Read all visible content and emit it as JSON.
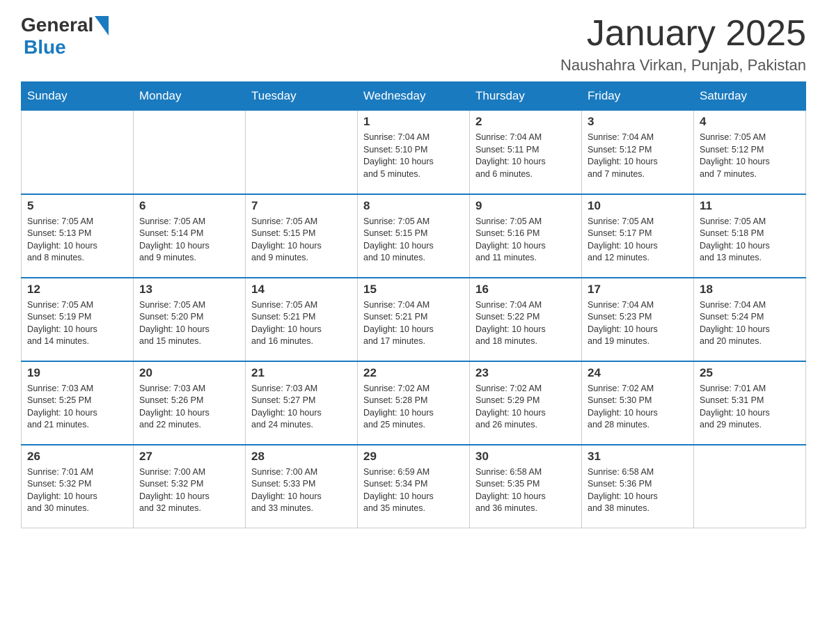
{
  "header": {
    "logo_general": "General",
    "logo_blue": "Blue",
    "month_title": "January 2025",
    "location": "Naushahra Virkan, Punjab, Pakistan"
  },
  "weekdays": [
    "Sunday",
    "Monday",
    "Tuesday",
    "Wednesday",
    "Thursday",
    "Friday",
    "Saturday"
  ],
  "weeks": [
    [
      {
        "day": "",
        "info": ""
      },
      {
        "day": "",
        "info": ""
      },
      {
        "day": "",
        "info": ""
      },
      {
        "day": "1",
        "info": "Sunrise: 7:04 AM\nSunset: 5:10 PM\nDaylight: 10 hours\nand 5 minutes."
      },
      {
        "day": "2",
        "info": "Sunrise: 7:04 AM\nSunset: 5:11 PM\nDaylight: 10 hours\nand 6 minutes."
      },
      {
        "day": "3",
        "info": "Sunrise: 7:04 AM\nSunset: 5:12 PM\nDaylight: 10 hours\nand 7 minutes."
      },
      {
        "day": "4",
        "info": "Sunrise: 7:05 AM\nSunset: 5:12 PM\nDaylight: 10 hours\nand 7 minutes."
      }
    ],
    [
      {
        "day": "5",
        "info": "Sunrise: 7:05 AM\nSunset: 5:13 PM\nDaylight: 10 hours\nand 8 minutes."
      },
      {
        "day": "6",
        "info": "Sunrise: 7:05 AM\nSunset: 5:14 PM\nDaylight: 10 hours\nand 9 minutes."
      },
      {
        "day": "7",
        "info": "Sunrise: 7:05 AM\nSunset: 5:15 PM\nDaylight: 10 hours\nand 9 minutes."
      },
      {
        "day": "8",
        "info": "Sunrise: 7:05 AM\nSunset: 5:15 PM\nDaylight: 10 hours\nand 10 minutes."
      },
      {
        "day": "9",
        "info": "Sunrise: 7:05 AM\nSunset: 5:16 PM\nDaylight: 10 hours\nand 11 minutes."
      },
      {
        "day": "10",
        "info": "Sunrise: 7:05 AM\nSunset: 5:17 PM\nDaylight: 10 hours\nand 12 minutes."
      },
      {
        "day": "11",
        "info": "Sunrise: 7:05 AM\nSunset: 5:18 PM\nDaylight: 10 hours\nand 13 minutes."
      }
    ],
    [
      {
        "day": "12",
        "info": "Sunrise: 7:05 AM\nSunset: 5:19 PM\nDaylight: 10 hours\nand 14 minutes."
      },
      {
        "day": "13",
        "info": "Sunrise: 7:05 AM\nSunset: 5:20 PM\nDaylight: 10 hours\nand 15 minutes."
      },
      {
        "day": "14",
        "info": "Sunrise: 7:05 AM\nSunset: 5:21 PM\nDaylight: 10 hours\nand 16 minutes."
      },
      {
        "day": "15",
        "info": "Sunrise: 7:04 AM\nSunset: 5:21 PM\nDaylight: 10 hours\nand 17 minutes."
      },
      {
        "day": "16",
        "info": "Sunrise: 7:04 AM\nSunset: 5:22 PM\nDaylight: 10 hours\nand 18 minutes."
      },
      {
        "day": "17",
        "info": "Sunrise: 7:04 AM\nSunset: 5:23 PM\nDaylight: 10 hours\nand 19 minutes."
      },
      {
        "day": "18",
        "info": "Sunrise: 7:04 AM\nSunset: 5:24 PM\nDaylight: 10 hours\nand 20 minutes."
      }
    ],
    [
      {
        "day": "19",
        "info": "Sunrise: 7:03 AM\nSunset: 5:25 PM\nDaylight: 10 hours\nand 21 minutes."
      },
      {
        "day": "20",
        "info": "Sunrise: 7:03 AM\nSunset: 5:26 PM\nDaylight: 10 hours\nand 22 minutes."
      },
      {
        "day": "21",
        "info": "Sunrise: 7:03 AM\nSunset: 5:27 PM\nDaylight: 10 hours\nand 24 minutes."
      },
      {
        "day": "22",
        "info": "Sunrise: 7:02 AM\nSunset: 5:28 PM\nDaylight: 10 hours\nand 25 minutes."
      },
      {
        "day": "23",
        "info": "Sunrise: 7:02 AM\nSunset: 5:29 PM\nDaylight: 10 hours\nand 26 minutes."
      },
      {
        "day": "24",
        "info": "Sunrise: 7:02 AM\nSunset: 5:30 PM\nDaylight: 10 hours\nand 28 minutes."
      },
      {
        "day": "25",
        "info": "Sunrise: 7:01 AM\nSunset: 5:31 PM\nDaylight: 10 hours\nand 29 minutes."
      }
    ],
    [
      {
        "day": "26",
        "info": "Sunrise: 7:01 AM\nSunset: 5:32 PM\nDaylight: 10 hours\nand 30 minutes."
      },
      {
        "day": "27",
        "info": "Sunrise: 7:00 AM\nSunset: 5:32 PM\nDaylight: 10 hours\nand 32 minutes."
      },
      {
        "day": "28",
        "info": "Sunrise: 7:00 AM\nSunset: 5:33 PM\nDaylight: 10 hours\nand 33 minutes."
      },
      {
        "day": "29",
        "info": "Sunrise: 6:59 AM\nSunset: 5:34 PM\nDaylight: 10 hours\nand 35 minutes."
      },
      {
        "day": "30",
        "info": "Sunrise: 6:58 AM\nSunset: 5:35 PM\nDaylight: 10 hours\nand 36 minutes."
      },
      {
        "day": "31",
        "info": "Sunrise: 6:58 AM\nSunset: 5:36 PM\nDaylight: 10 hours\nand 38 minutes."
      },
      {
        "day": "",
        "info": ""
      }
    ]
  ]
}
